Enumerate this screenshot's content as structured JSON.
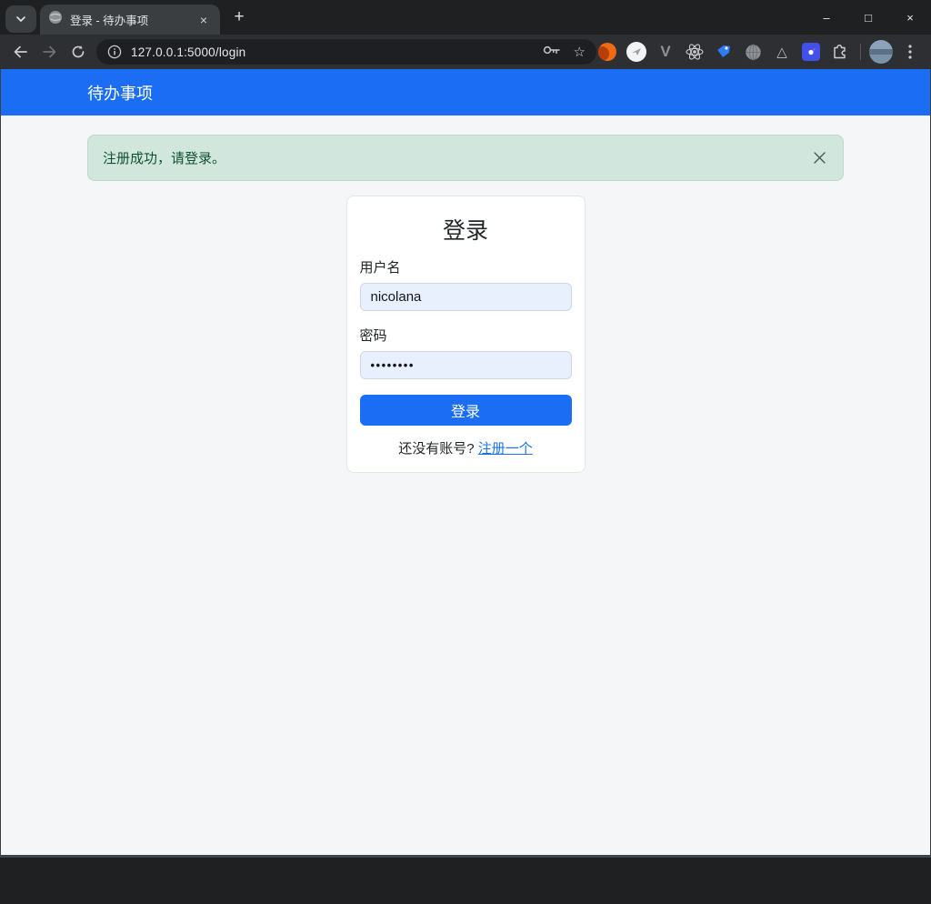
{
  "browser": {
    "tab_title": "登录 - 待办事项",
    "tab_close_glyph": "×",
    "new_tab_glyph": "+",
    "window_controls": {
      "minimize": "–",
      "maximize": "□",
      "close": "×"
    },
    "address": "127.0.0.1:5000/login",
    "bookmark_star_glyph": "☆",
    "extension_glyphs": {
      "vimium": "V",
      "triangle": "△"
    }
  },
  "page": {
    "navbar": {
      "brand": "待办事项"
    },
    "alert": {
      "message": "注册成功，请登录。"
    },
    "card": {
      "title": "登录",
      "username_label": "用户名",
      "username_value": "nicolana",
      "password_label": "密码",
      "password_value": "••••••••",
      "submit_label": "登录",
      "signup_prompt": "还没有账号?",
      "signup_link_label": "注册一个"
    },
    "colors": {
      "primary": "#1b6ef3",
      "success_bg": "#d1e7dd",
      "success_text": "#0f5132",
      "autofill_bg": "#e8f0fe",
      "page_bg": "#f4f6f8"
    }
  }
}
